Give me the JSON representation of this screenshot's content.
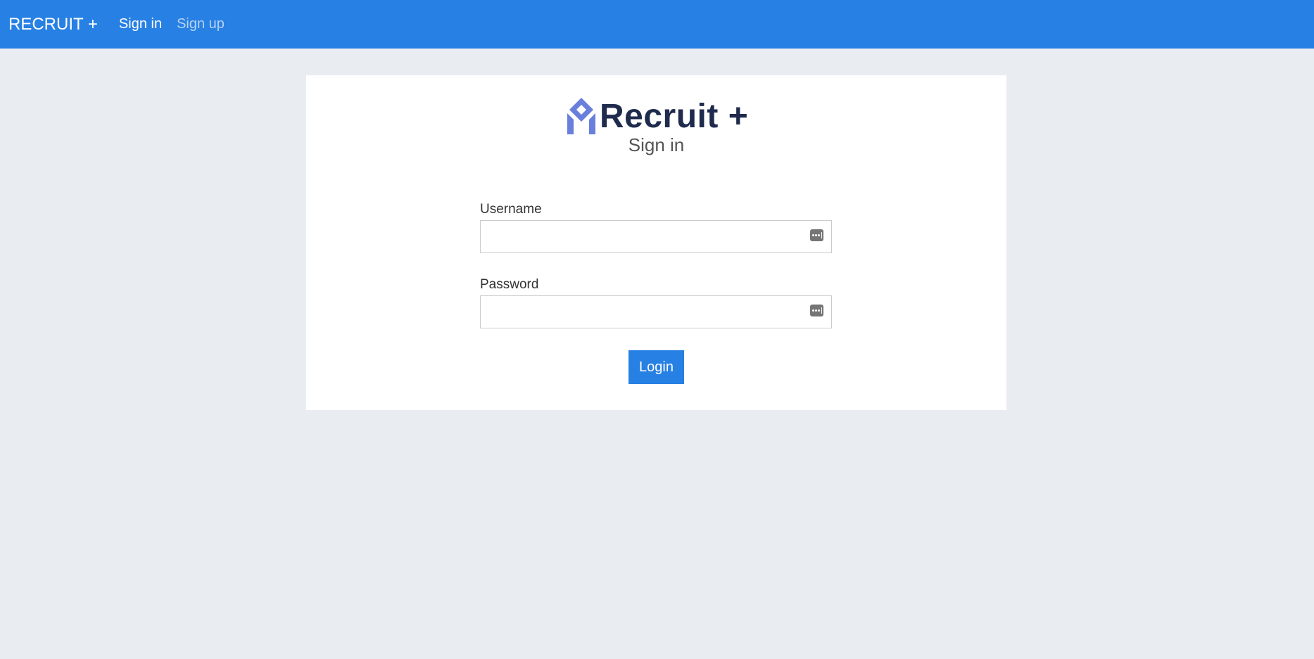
{
  "navbar": {
    "brand": "RECRUIT +",
    "links": [
      {
        "label": "Sign in",
        "active": true
      },
      {
        "label": "Sign up",
        "active": false
      }
    ]
  },
  "logo": {
    "text": "Recruit +",
    "icon": "recruit-logo-icon"
  },
  "page_title": "Sign in",
  "form": {
    "username": {
      "label": "Username",
      "value": "",
      "placeholder": ""
    },
    "password": {
      "label": "Password",
      "value": "",
      "placeholder": ""
    },
    "field_icon": "password-manager-icon",
    "submit_label": "Login"
  },
  "colors": {
    "primary": "#2780e3",
    "background": "#e9edf2",
    "logo_text": "#1f2b4d",
    "logo_icon": "#6a7fdb"
  }
}
